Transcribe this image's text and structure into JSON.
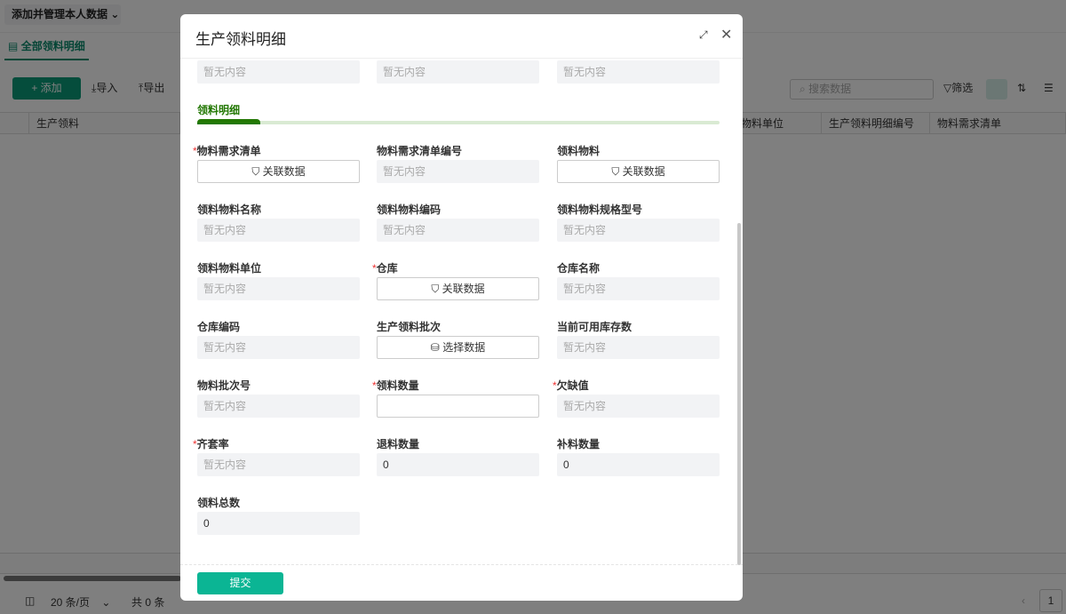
{
  "background": {
    "view_selector": "添加并管理本人数据",
    "tab": "全部领料明细",
    "toolbar": {
      "add": "添加",
      "import": "导入",
      "export": "导出",
      "search_placeholder": "搜索数据",
      "filter": "筛选"
    },
    "columns": [
      "生产领料",
      "物料单位",
      "生产领料明细编号",
      "物料需求清单"
    ],
    "pagination": {
      "page_size": "20 条/页",
      "total": "共 0 条",
      "page": "1"
    }
  },
  "modal": {
    "title": "生产领料明细",
    "top_row": [
      "暂无内容",
      "暂无内容",
      "暂无内容"
    ],
    "section_title": "领料明细",
    "section_progress": 0.12,
    "fields": [
      {
        "label": "物料需求清单",
        "required": true,
        "type": "link",
        "value": "关联数据"
      },
      {
        "label": "物料需求清单编号",
        "required": false,
        "type": "empty",
        "value": "暂无内容"
      },
      {
        "label": "领料物料",
        "required": false,
        "type": "link",
        "value": "关联数据"
      },
      {
        "label": "领料物料名称",
        "required": false,
        "type": "empty",
        "value": "暂无内容"
      },
      {
        "label": "领料物料编码",
        "required": false,
        "type": "empty",
        "value": "暂无内容"
      },
      {
        "label": "领料物料规格型号",
        "required": false,
        "type": "empty",
        "value": "暂无内容"
      },
      {
        "label": "领料物料单位",
        "required": false,
        "type": "empty",
        "value": "暂无内容"
      },
      {
        "label": "仓库",
        "required": true,
        "type": "link",
        "value": "关联数据"
      },
      {
        "label": "仓库名称",
        "required": false,
        "type": "empty",
        "value": "暂无内容"
      },
      {
        "label": "仓库编码",
        "required": false,
        "type": "empty",
        "value": "暂无内容"
      },
      {
        "label": "生产领料批次",
        "required": false,
        "type": "select",
        "value": "选择数据"
      },
      {
        "label": "当前可用库存数",
        "required": false,
        "type": "empty",
        "value": "暂无内容"
      },
      {
        "label": "物料批次号",
        "required": false,
        "type": "empty",
        "value": "暂无内容"
      },
      {
        "label": "领料数量",
        "required": true,
        "type": "input",
        "value": ""
      },
      {
        "label": "欠缺值",
        "required": true,
        "type": "empty",
        "value": "暂无内容"
      },
      {
        "label": "齐套率",
        "required": true,
        "type": "empty",
        "value": "暂无内容"
      },
      {
        "label": "退料数量",
        "required": false,
        "type": "value",
        "value": "0"
      },
      {
        "label": "补料数量",
        "required": false,
        "type": "value",
        "value": "0"
      },
      {
        "label": "领料总数",
        "required": false,
        "type": "value",
        "value": "0"
      }
    ],
    "submit": "提交",
    "accent": "#0bb594"
  }
}
